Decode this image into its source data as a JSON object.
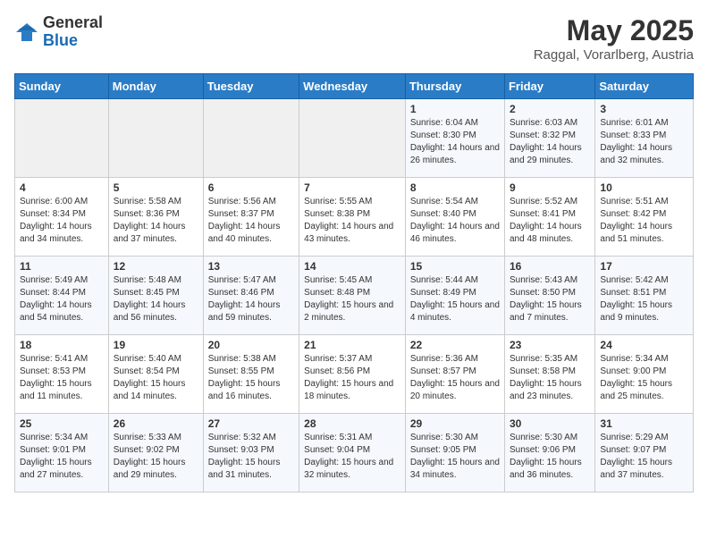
{
  "header": {
    "logo_general": "General",
    "logo_blue": "Blue",
    "month_title": "May 2025",
    "subtitle": "Raggal, Vorarlberg, Austria"
  },
  "weekdays": [
    "Sunday",
    "Monday",
    "Tuesday",
    "Wednesday",
    "Thursday",
    "Friday",
    "Saturday"
  ],
  "weeks": [
    [
      {
        "day": "",
        "sunrise": "",
        "sunset": "",
        "daylight": "",
        "empty": true
      },
      {
        "day": "",
        "sunrise": "",
        "sunset": "",
        "daylight": "",
        "empty": true
      },
      {
        "day": "",
        "sunrise": "",
        "sunset": "",
        "daylight": "",
        "empty": true
      },
      {
        "day": "",
        "sunrise": "",
        "sunset": "",
        "daylight": "",
        "empty": true
      },
      {
        "day": "1",
        "sunrise": "Sunrise: 6:04 AM",
        "sunset": "Sunset: 8:30 PM",
        "daylight": "Daylight: 14 hours and 26 minutes."
      },
      {
        "day": "2",
        "sunrise": "Sunrise: 6:03 AM",
        "sunset": "Sunset: 8:32 PM",
        "daylight": "Daylight: 14 hours and 29 minutes."
      },
      {
        "day": "3",
        "sunrise": "Sunrise: 6:01 AM",
        "sunset": "Sunset: 8:33 PM",
        "daylight": "Daylight: 14 hours and 32 minutes."
      }
    ],
    [
      {
        "day": "4",
        "sunrise": "Sunrise: 6:00 AM",
        "sunset": "Sunset: 8:34 PM",
        "daylight": "Daylight: 14 hours and 34 minutes."
      },
      {
        "day": "5",
        "sunrise": "Sunrise: 5:58 AM",
        "sunset": "Sunset: 8:36 PM",
        "daylight": "Daylight: 14 hours and 37 minutes."
      },
      {
        "day": "6",
        "sunrise": "Sunrise: 5:56 AM",
        "sunset": "Sunset: 8:37 PM",
        "daylight": "Daylight: 14 hours and 40 minutes."
      },
      {
        "day": "7",
        "sunrise": "Sunrise: 5:55 AM",
        "sunset": "Sunset: 8:38 PM",
        "daylight": "Daylight: 14 hours and 43 minutes."
      },
      {
        "day": "8",
        "sunrise": "Sunrise: 5:54 AM",
        "sunset": "Sunset: 8:40 PM",
        "daylight": "Daylight: 14 hours and 46 minutes."
      },
      {
        "day": "9",
        "sunrise": "Sunrise: 5:52 AM",
        "sunset": "Sunset: 8:41 PM",
        "daylight": "Daylight: 14 hours and 48 minutes."
      },
      {
        "day": "10",
        "sunrise": "Sunrise: 5:51 AM",
        "sunset": "Sunset: 8:42 PM",
        "daylight": "Daylight: 14 hours and 51 minutes."
      }
    ],
    [
      {
        "day": "11",
        "sunrise": "Sunrise: 5:49 AM",
        "sunset": "Sunset: 8:44 PM",
        "daylight": "Daylight: 14 hours and 54 minutes."
      },
      {
        "day": "12",
        "sunrise": "Sunrise: 5:48 AM",
        "sunset": "Sunset: 8:45 PM",
        "daylight": "Daylight: 14 hours and 56 minutes."
      },
      {
        "day": "13",
        "sunrise": "Sunrise: 5:47 AM",
        "sunset": "Sunset: 8:46 PM",
        "daylight": "Daylight: 14 hours and 59 minutes."
      },
      {
        "day": "14",
        "sunrise": "Sunrise: 5:45 AM",
        "sunset": "Sunset: 8:48 PM",
        "daylight": "Daylight: 15 hours and 2 minutes."
      },
      {
        "day": "15",
        "sunrise": "Sunrise: 5:44 AM",
        "sunset": "Sunset: 8:49 PM",
        "daylight": "Daylight: 15 hours and 4 minutes."
      },
      {
        "day": "16",
        "sunrise": "Sunrise: 5:43 AM",
        "sunset": "Sunset: 8:50 PM",
        "daylight": "Daylight: 15 hours and 7 minutes."
      },
      {
        "day": "17",
        "sunrise": "Sunrise: 5:42 AM",
        "sunset": "Sunset: 8:51 PM",
        "daylight": "Daylight: 15 hours and 9 minutes."
      }
    ],
    [
      {
        "day": "18",
        "sunrise": "Sunrise: 5:41 AM",
        "sunset": "Sunset: 8:53 PM",
        "daylight": "Daylight: 15 hours and 11 minutes."
      },
      {
        "day": "19",
        "sunrise": "Sunrise: 5:40 AM",
        "sunset": "Sunset: 8:54 PM",
        "daylight": "Daylight: 15 hours and 14 minutes."
      },
      {
        "day": "20",
        "sunrise": "Sunrise: 5:38 AM",
        "sunset": "Sunset: 8:55 PM",
        "daylight": "Daylight: 15 hours and 16 minutes."
      },
      {
        "day": "21",
        "sunrise": "Sunrise: 5:37 AM",
        "sunset": "Sunset: 8:56 PM",
        "daylight": "Daylight: 15 hours and 18 minutes."
      },
      {
        "day": "22",
        "sunrise": "Sunrise: 5:36 AM",
        "sunset": "Sunset: 8:57 PM",
        "daylight": "Daylight: 15 hours and 20 minutes."
      },
      {
        "day": "23",
        "sunrise": "Sunrise: 5:35 AM",
        "sunset": "Sunset: 8:58 PM",
        "daylight": "Daylight: 15 hours and 23 minutes."
      },
      {
        "day": "24",
        "sunrise": "Sunrise: 5:34 AM",
        "sunset": "Sunset: 9:00 PM",
        "daylight": "Daylight: 15 hours and 25 minutes."
      }
    ],
    [
      {
        "day": "25",
        "sunrise": "Sunrise: 5:34 AM",
        "sunset": "Sunset: 9:01 PM",
        "daylight": "Daylight: 15 hours and 27 minutes."
      },
      {
        "day": "26",
        "sunrise": "Sunrise: 5:33 AM",
        "sunset": "Sunset: 9:02 PM",
        "daylight": "Daylight: 15 hours and 29 minutes."
      },
      {
        "day": "27",
        "sunrise": "Sunrise: 5:32 AM",
        "sunset": "Sunset: 9:03 PM",
        "daylight": "Daylight: 15 hours and 31 minutes."
      },
      {
        "day": "28",
        "sunrise": "Sunrise: 5:31 AM",
        "sunset": "Sunset: 9:04 PM",
        "daylight": "Daylight: 15 hours and 32 minutes."
      },
      {
        "day": "29",
        "sunrise": "Sunrise: 5:30 AM",
        "sunset": "Sunset: 9:05 PM",
        "daylight": "Daylight: 15 hours and 34 minutes."
      },
      {
        "day": "30",
        "sunrise": "Sunrise: 5:30 AM",
        "sunset": "Sunset: 9:06 PM",
        "daylight": "Daylight: 15 hours and 36 minutes."
      },
      {
        "day": "31",
        "sunrise": "Sunrise: 5:29 AM",
        "sunset": "Sunset: 9:07 PM",
        "daylight": "Daylight: 15 hours and 37 minutes."
      }
    ]
  ]
}
